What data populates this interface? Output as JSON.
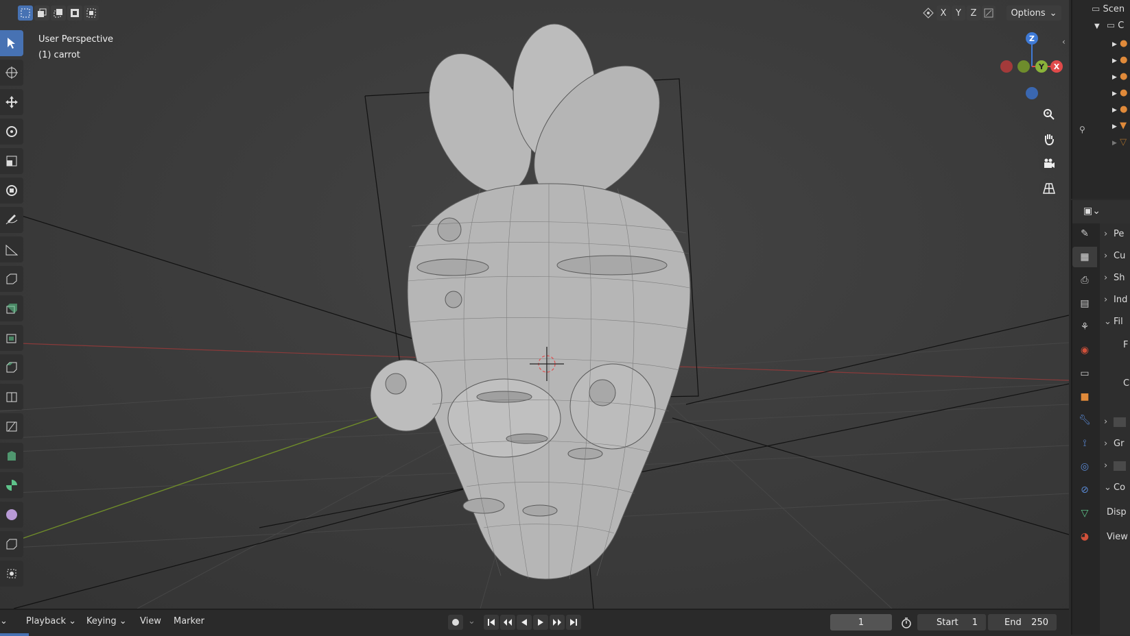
{
  "viewport": {
    "view_name": "User Perspective",
    "object_label": "(1) carrot"
  },
  "header": {
    "axis_labels": [
      "X",
      "Y",
      "Z"
    ],
    "options_label": "Options"
  },
  "gizmo": {
    "z_label": "Z",
    "y_label": "Y",
    "x_label": "X"
  },
  "outliner": {
    "scene_label": "Scen",
    "collection_label": "C"
  },
  "properties": {
    "sections": [
      "Pe",
      "Cu",
      "Sh",
      "Ind",
      "Fil",
      "F",
      "C",
      "",
      "Gr",
      "",
      "Co",
      "Disp",
      "View"
    ]
  },
  "timeline": {
    "menus": [
      "Playback",
      "Keying",
      "View",
      "Marker"
    ],
    "current_frame": "1",
    "start_label": "Start",
    "start_value": "1",
    "end_label": "End",
    "end_value": "250"
  },
  "colors": {
    "accent": "#4772b3",
    "axis_x": "#e04a4a",
    "axis_y": "#8ab33a",
    "axis_z": "#3f7ad6"
  }
}
